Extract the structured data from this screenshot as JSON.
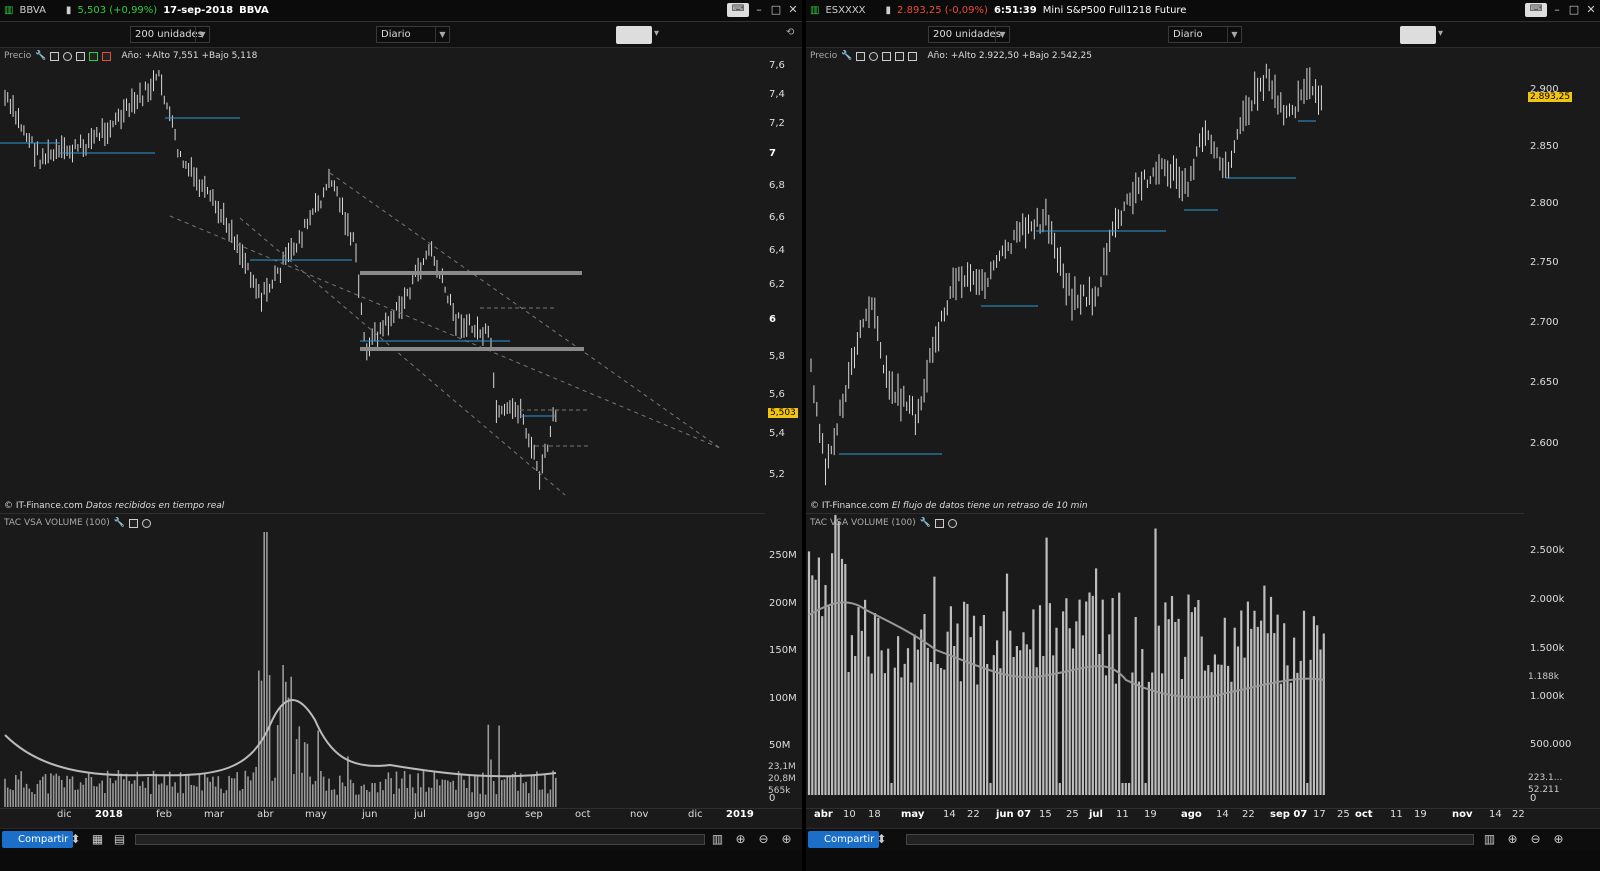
{
  "left": {
    "symbol": "BBVA",
    "last": "5,503 (+0,99%)",
    "date": "17-sep-2018",
    "name": "BBVA",
    "units": "200 unidades",
    "period": "Diario",
    "price_label": "Precio",
    "annual": "Año: +Alto 7,551 +Bajo 5,118",
    "credit_brand": "© IT-Finance.com",
    "credit_note": "Datos recibidos en tiempo real",
    "volume_label": "TAC VSA VOLUME (100)",
    "y_ticks": [
      "7,6",
      "7,4",
      "7,2",
      "7",
      "6,8",
      "6,6",
      "6,4",
      "6,2",
      "6",
      "5,8",
      "5,6",
      "5,4",
      "5,2"
    ],
    "price_tag": "5,503",
    "vol_ticks": [
      "250M",
      "200M",
      "150M",
      "100M",
      "50M",
      "0"
    ],
    "vol_tags": [
      "23,1M",
      "20,8M",
      "565k"
    ],
    "x_ticks": [
      "dic",
      "2018",
      "feb",
      "mar",
      "abr",
      "may",
      "jun",
      "jul",
      "ago",
      "sep",
      "oct",
      "nov",
      "dic",
      "2019"
    ],
    "share_label": "Compartir",
    "icon_colors": {
      "up": "#2ecc40",
      "down": "#e74c3c",
      "accent": "#1b6fc9",
      "highlight": "#f1c40f"
    }
  },
  "right": {
    "symbol": "ESXXXX",
    "last": "2.893,25 (-0,09%)",
    "date": "6:51:39",
    "name": "Mini S&P500 Full1218 Future",
    "units": "200 unidades",
    "period": "Diario",
    "price_label": "Precio",
    "annual": "Año: +Alto 2.922,50 +Bajo 2.542,25",
    "credit_brand": "© IT-Finance.com",
    "credit_note": "El flujo de datos tiene un retraso de 10 min",
    "volume_label": "TAC VSA VOLUME (100)",
    "y_ticks": [
      "2.900",
      "2.850",
      "2.800",
      "2.750",
      "2.700",
      "2.650",
      "2.600"
    ],
    "price_tag": "2.893,25",
    "vol_ticks": [
      "2.500k",
      "2.000k",
      "1.500k",
      "1.000k",
      "500.000",
      "0"
    ],
    "vol_tags": [
      "1.188k",
      "223.1...",
      "52.211"
    ],
    "x_ticks": [
      "abr",
      "10",
      "18",
      "may",
      "14",
      "22",
      "jun 07",
      "15",
      "25",
      "jul",
      "11",
      "19",
      "ago",
      "14",
      "22",
      "sep 07",
      "17",
      "25",
      "oct",
      "11",
      "19",
      "nov",
      "14",
      "22"
    ],
    "share_label": "Compartir"
  }
}
